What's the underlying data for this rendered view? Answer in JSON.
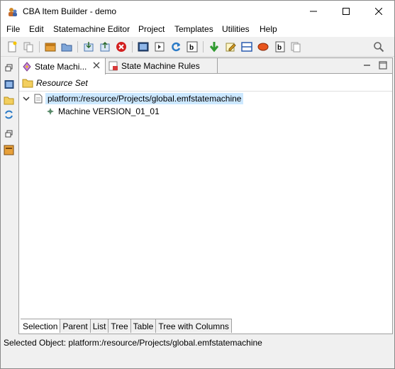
{
  "window": {
    "title": "CBA Item Builder - demo"
  },
  "menu": [
    "File",
    "Edit",
    "Statemachine Editor",
    "Project",
    "Templates",
    "Utilities",
    "Help"
  ],
  "editor": {
    "tabs": [
      {
        "label": "State Machi...",
        "active": true
      },
      {
        "label": "State Machine Rules",
        "active": false
      }
    ],
    "resource_set_label": "Resource Set",
    "tree": {
      "root": "platform:/resource/Projects/global.emfstatemachine",
      "child": "Machine VERSION_01_01"
    },
    "bottom_tabs": [
      "Selection",
      "Parent",
      "List",
      "Tree",
      "Table",
      "Tree with Columns"
    ]
  },
  "status": {
    "text": "Selected Object: platform:/resource/Projects/global.emfstatemachine"
  },
  "icons": {
    "toolbar": [
      "new-file-icon",
      "copy-icon",
      "archive-icon",
      "open-folder-icon",
      "import-icon",
      "export-icon",
      "stop-icon",
      "preview-icon",
      "run-icon",
      "refresh-icon",
      "text-icon",
      "download-icon",
      "edit-icon",
      "layout-icon",
      "record-icon",
      "text-format-icon",
      "pages-icon",
      "search-icon"
    ],
    "colors": {
      "selection": "#cce8ff",
      "stop": "#d32020"
    }
  }
}
